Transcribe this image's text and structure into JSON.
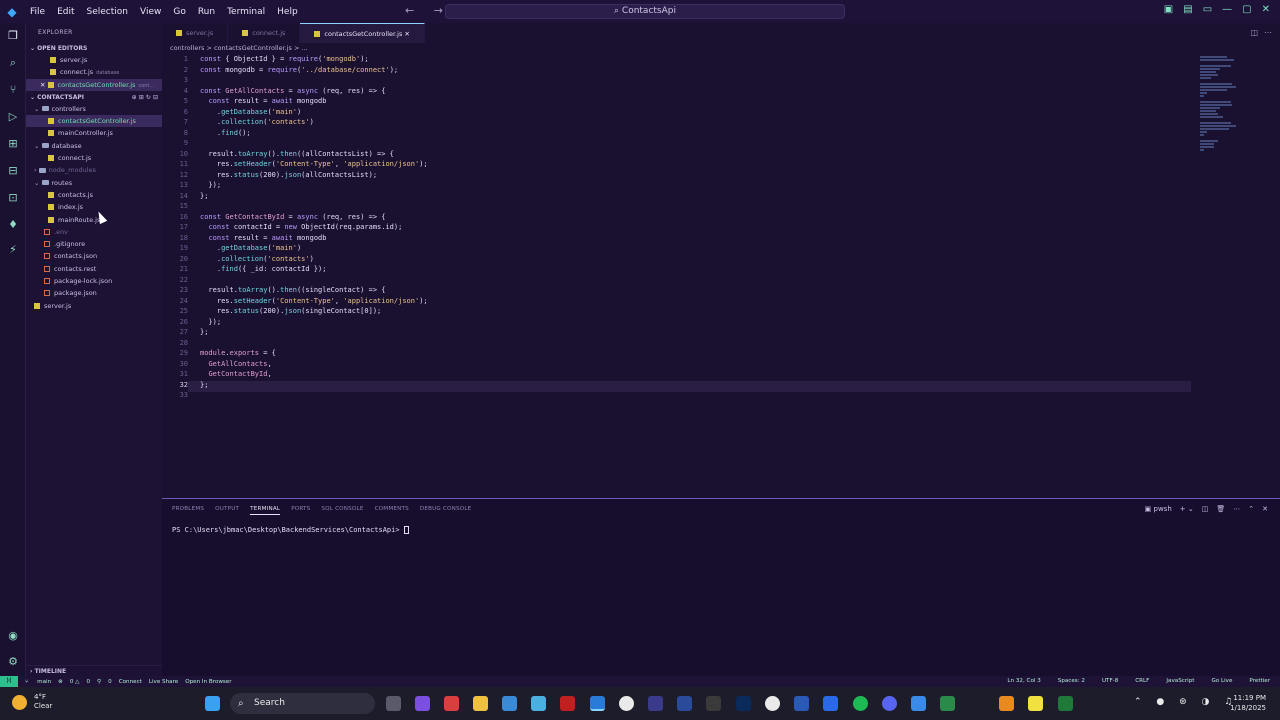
{
  "menu": [
    "File",
    "Edit",
    "Selection",
    "View",
    "Go",
    "Run",
    "Terminal",
    "Help"
  ],
  "command_center": "ContactsApi",
  "sidebar": {
    "title": "EXPLORER",
    "open_editors_label": "OPEN EDITORS",
    "open_editors": [
      {
        "name": "server.js",
        "hint": ""
      },
      {
        "name": "connect.js",
        "hint": "database"
      },
      {
        "name": "contactsGetController.js",
        "hint": "cont..."
      }
    ],
    "project_label": "CONTACTSAPI",
    "tree": [
      {
        "name": "controllers",
        "type": "folder",
        "depth": 1
      },
      {
        "name": "contactsGetController.js",
        "type": "js",
        "depth": 2
      },
      {
        "name": "mainController.js",
        "type": "js",
        "depth": 2
      },
      {
        "name": "database",
        "type": "folder",
        "depth": 1
      },
      {
        "name": "connect.js",
        "type": "js",
        "depth": 2
      },
      {
        "name": "node_modules",
        "type": "folder",
        "depth": 1
      },
      {
        "name": "routes",
        "type": "folder",
        "depth": 1
      },
      {
        "name": "contacts.js",
        "type": "js",
        "depth": 2
      },
      {
        "name": "index.js",
        "type": "js",
        "depth": 2
      },
      {
        "name": "mainRoute.js",
        "type": "js",
        "depth": 2
      },
      {
        "name": ".env",
        "type": "cfg",
        "depth": 1
      },
      {
        "name": ".gitignore",
        "type": "cfg",
        "depth": 1
      },
      {
        "name": "contacts.json",
        "type": "json",
        "depth": 1
      },
      {
        "name": "contacts.rest",
        "type": "json",
        "depth": 1
      },
      {
        "name": "package-lock.json",
        "type": "json",
        "depth": 1
      },
      {
        "name": "package.json",
        "type": "json",
        "depth": 1
      },
      {
        "name": "server.js",
        "type": "js",
        "depth": 1
      }
    ],
    "timeline_label": "TIMELINE"
  },
  "tabs": [
    "server.js",
    "connect.js",
    "contactsGetController.js"
  ],
  "breadcrumb": "controllers > contactsGetController.js > ...",
  "code_lines": [
    "const { ObjectId } = require('mongodb');",
    "const mongodb = require('../database/connect');",
    "",
    "const GetAllContacts = async (req, res) => {",
    "  const result = await mongodb",
    "    .getDatabase('main')",
    "    .collection('contacts')",
    "    .find();",
    "",
    "  result.toArray().then((allContactsList) => {",
    "    res.setHeader('Content-Type', 'application/json');",
    "    res.status(200).json(allContactsList);",
    "  });",
    "};",
    "",
    "const GetContactById = async (req, res) => {",
    "  const contactId = new ObjectId(req.params.id);",
    "  const result = await mongodb",
    "    .getDatabase('main')",
    "    .collection('contacts')",
    "    .find({ _id: contactId });",
    "",
    "  result.toArray().then((singleContact) => {",
    "    res.setHeader('Content-Type', 'application/json');",
    "    res.status(200).json(singleContact[0]);",
    "  });",
    "};",
    "",
    "module.exports = {",
    "  GetAllContacts,",
    "  GetContactById,",
    "};",
    ""
  ],
  "panel": {
    "tabs": [
      "PROBLEMS",
      "OUTPUT",
      "TERMINAL",
      "PORTS",
      "SQL CONSOLE",
      "COMMENTS",
      "DEBUG CONSOLE"
    ],
    "active_tab": "TERMINAL",
    "shell": "pwsh",
    "prompt": "PS C:\\Users\\jbmac\\Desktop\\BackendServices\\ContactsApi> "
  },
  "statusbar": {
    "branch": "main",
    "errors": "0",
    "warnings": "0",
    "ports": "0",
    "connect": "Connect",
    "live_share": "Live Share",
    "open_browser": "Open In Browser",
    "position": "Ln 32, Col 3",
    "spaces": "Spaces: 2",
    "encoding": "UTF-8",
    "eol": "CRLF",
    "language": "JavaScript",
    "golive": "Go Live",
    "prettier": "Prettier"
  },
  "taskbar": {
    "temp": "4°F",
    "weather": "Clear",
    "search": "Search",
    "time": "11:19 PM",
    "date": "1/18/2025"
  }
}
